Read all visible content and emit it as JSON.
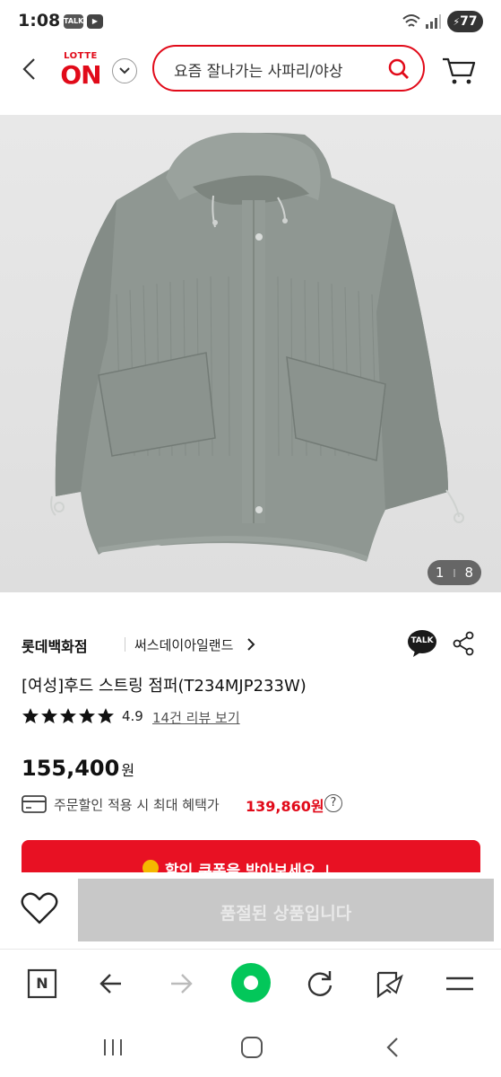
{
  "status_bar": {
    "time": "1:08",
    "talk_badge": "TALK",
    "battery": "77"
  },
  "header": {
    "logo_top": "LOTTE",
    "logo_main": "ON",
    "search_placeholder": "요즘 잘나가는 사파리/야상"
  },
  "gallery": {
    "current": "1",
    "separator": "I",
    "total": "8"
  },
  "product": {
    "store": "롯데백화점",
    "brand": "써스데이아일랜드",
    "title": "[여성]후드 스트링 점퍼(T234MJP233W)",
    "rating": "4.9",
    "stars": 5,
    "review_link": "14건 리뷰 보기",
    "price": "155,400",
    "price_unit": "원",
    "benefit_label": "주문할인 적용 시 최대 혜택가",
    "benefit_price": "139,860원",
    "help": "?",
    "talk_label": "TALK"
  },
  "coupon": {
    "label": "할인 쿠폰을 받아보세요 ↓"
  },
  "purchase": {
    "soldout_label": "품절된 상품입니다"
  },
  "browser_toolbar": {
    "items": [
      "naver-home",
      "back",
      "forward",
      "green-dot",
      "reload",
      "bookmark",
      "menu"
    ],
    "naver_letter": "N"
  },
  "colors": {
    "brand_red": "#e10a19",
    "coupon_red": "#e81123",
    "soldout_gray": "#c8c8c8",
    "naver_green": "#03c75a"
  }
}
